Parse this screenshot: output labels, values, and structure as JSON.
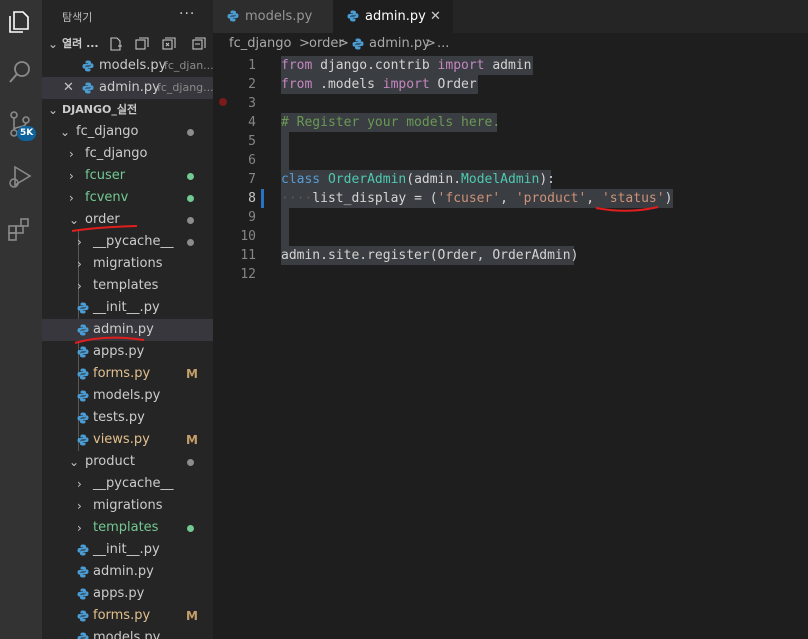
{
  "colors": {
    "green": "#73c991",
    "yellow": "#e2c08d",
    "gray": "#8c8c8c",
    "annotation_red": "#e01e1e",
    "python_blue": "#4b9cd3"
  },
  "activity_bar": {
    "icons": [
      "explorer-icon",
      "search-icon",
      "source-control-icon",
      "run-debug-icon",
      "extensions-icon"
    ],
    "scm_badge": "5K"
  },
  "sidebar": {
    "title": "탐색기",
    "more": "···",
    "open_editors": {
      "label": "열려 ...",
      "items": [
        {
          "name": "models.py",
          "desc": "fc_djan..."
        },
        {
          "name": "admin.py",
          "desc": "fc_djang..."
        }
      ]
    },
    "project": {
      "label": "DJANGO_실전",
      "rows": [
        {
          "label": "fc_django",
          "status": "gray"
        },
        {
          "label": "fc_django",
          "status": ""
        },
        {
          "label": "fcuser",
          "status": "green"
        },
        {
          "label": "fcvenv",
          "status": "green"
        },
        {
          "label": "order",
          "status": "gray"
        },
        {
          "label": "__pycache__",
          "status": "gray"
        },
        {
          "label": "migrations",
          "status": ""
        },
        {
          "label": "templates",
          "status": ""
        },
        {
          "label": "__init__.py",
          "status": ""
        },
        {
          "label": "admin.py",
          "status": ""
        },
        {
          "label": "apps.py",
          "status": ""
        },
        {
          "label": "forms.py",
          "status": "M"
        },
        {
          "label": "models.py",
          "status": ""
        },
        {
          "label": "tests.py",
          "status": ""
        },
        {
          "label": "views.py",
          "status": "M"
        },
        {
          "label": "product",
          "status": "gray"
        },
        {
          "label": "__pycache__",
          "status": ""
        },
        {
          "label": "migrations",
          "status": ""
        },
        {
          "label": "templates",
          "status": "green"
        },
        {
          "label": "__init__.py",
          "status": ""
        },
        {
          "label": "admin.py",
          "status": ""
        },
        {
          "label": "apps.py",
          "status": ""
        },
        {
          "label": "forms.py",
          "status": "M"
        },
        {
          "label": "models.py",
          "status": ""
        }
      ]
    }
  },
  "tabs": [
    {
      "label": "models.py"
    },
    {
      "label": "admin.py",
      "close": "✕"
    }
  ],
  "breadcrumb": [
    "fc_django",
    ">",
    "order",
    ">",
    "admin.py",
    ">",
    "..."
  ],
  "editor": {
    "line_numbers": [
      "1",
      "2",
      "3",
      "4",
      "5",
      "6",
      "7",
      "8",
      "9",
      "10",
      "11",
      "12"
    ],
    "lines": [
      [
        [
          "kw",
          "from"
        ],
        [
          "",
          " django.contrib "
        ],
        [
          "kw",
          "import"
        ],
        [
          "",
          " admin "
        ]
      ],
      [
        [
          "kw",
          "from"
        ],
        [
          "",
          " .models "
        ],
        [
          "kw",
          "import"
        ],
        [
          "",
          " Order "
        ]
      ],
      [],
      [
        [
          "com",
          "# Register your models here."
        ]
      ],
      [],
      [],
      [
        [
          "kwb",
          "class"
        ],
        [
          "",
          " "
        ],
        [
          "cls",
          "OrderAdmin"
        ],
        [
          "",
          "(admin."
        ],
        [
          "cls",
          "ModelAdmin"
        ],
        [
          "",
          "):"
        ]
      ],
      [
        [
          "ws",
          "····"
        ],
        [
          "",
          "list_display "
        ],
        [
          "",
          "="
        ],
        [
          "",
          " ("
        ],
        [
          "str",
          "'fcuser'"
        ],
        [
          "",
          ", "
        ],
        [
          "str",
          "'product'"
        ],
        [
          "",
          ", "
        ],
        [
          "str",
          "'status'"
        ],
        [
          "",
          ")"
        ]
      ],
      [],
      [],
      [
        [
          "",
          "admin.site.register(Order, OrderAdmin)"
        ]
      ],
      []
    ]
  }
}
